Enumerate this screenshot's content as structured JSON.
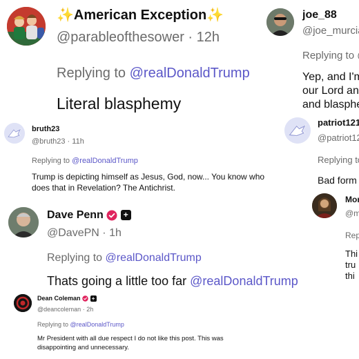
{
  "colors": {
    "mention": "#5b57c8",
    "secondary_text": "#6b6b6b",
    "verified_badge": "#e0245e",
    "sparkle": "#e8b43c"
  },
  "posts": {
    "american": {
      "sparkle_left": "✨",
      "name": "American Exception",
      "sparkle_right": "✨",
      "handle": "@parableofthesower",
      "time": "12h",
      "reply_prefix": "Replying to",
      "reply_to": "@realDonaldTrump",
      "text": "Literal blasphemy"
    },
    "joe": {
      "name": "joe_88",
      "handle": "@joe_murcia",
      "reply_prefix": "Replying to @",
      "text_line1": "Yep, and I'm",
      "text_line2": "our Lord an",
      "text_line3": "and blasphe"
    },
    "bruth": {
      "name": "bruth23",
      "handle": "@bruth23",
      "time": "11h",
      "reply_prefix": "Replying to",
      "reply_to": "@realDonaldTrump",
      "text_line1": "Trump is depicting himself as Jesus, God, now... You know who",
      "text_line2": "does that in Revelation? The Antichrist."
    },
    "patriot": {
      "name": "patriot121",
      "handle": "@patriot12",
      "reply_prefix": "Replying to",
      "text": "Bad form"
    },
    "dave": {
      "name": "Dave Penn",
      "handle": "@DavePN",
      "time": "1h",
      "reply_prefix": "Replying to",
      "reply_to": "@realDonaldTrump",
      "text_prefix": "Thats going a little too far",
      "text_mention": "@realDonaldTrump"
    },
    "mor": {
      "name": "Mor",
      "handle": "@m",
      "reply_prefix": "Rep",
      "text_line1": "Thi",
      "text_line2": "tru",
      "text_line3": "thi"
    },
    "dean": {
      "name": "Dean Coleman",
      "handle": "@deancoleman",
      "time": "2h",
      "reply_prefix": "Replying to",
      "reply_to": "@realDonaldTrump",
      "text_line1": "Mr President with all due respect I do not like this post. This was",
      "text_line2": "disappointing and unnecessary."
    }
  },
  "separators": {
    "dot": "·",
    "plus": "+"
  },
  "icons": {
    "verified": "verified-badge-icon",
    "plus_square": "plus-square-icon",
    "eagle": "eagle-avatar-icon"
  }
}
